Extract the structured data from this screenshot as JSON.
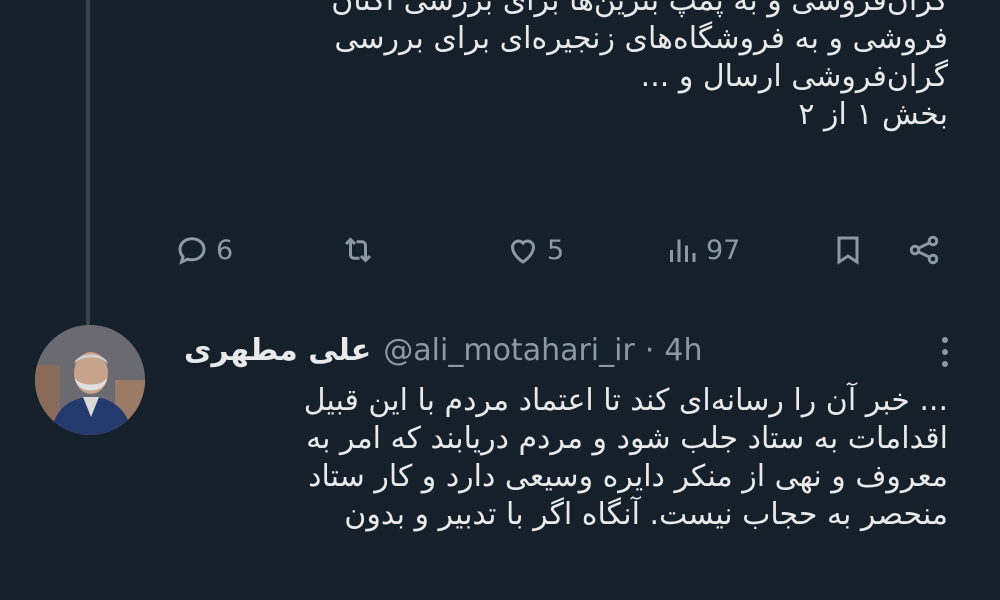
{
  "tweet1": {
    "lines": [
      "گران‌فروشی و به پمپ بنزین‌ها برای بررسی اکتان",
      "فروشی و به فروشگاه‌های زنجیره‌ای برای بررسی",
      "گران‌فروشی ارسال و ...",
      "بخش ۱ از ۲"
    ],
    "actions": {
      "reply_count": "6",
      "retweet_count": "",
      "like_count": "5",
      "views_count": "97"
    }
  },
  "tweet2": {
    "author_name": "علی مطهری",
    "handle": "@ali_motahari_ir",
    "separator": "·",
    "time": "4h",
    "lines": [
      "... خبر آن را رسانه‌ای کند تا اعتماد مردم با این قبیل",
      "اقدامات به ستاد جلب شود و مردم دریابند که امر به",
      "معروف و نهی از منکر دایره وسیعی دارد و کار ستاد",
      "منحصر به حجاب نیست. آنگاه اگر با تدبیر و بدون"
    ]
  },
  "colors": {
    "background": "#15202b",
    "text": "#e7e9ea",
    "secondary": "#8b98a5",
    "thread_line": "#38444d"
  },
  "icons": [
    "reply-icon",
    "retweet-icon",
    "like-icon",
    "views-icon",
    "bookmark-icon",
    "share-icon",
    "more-icon"
  ]
}
